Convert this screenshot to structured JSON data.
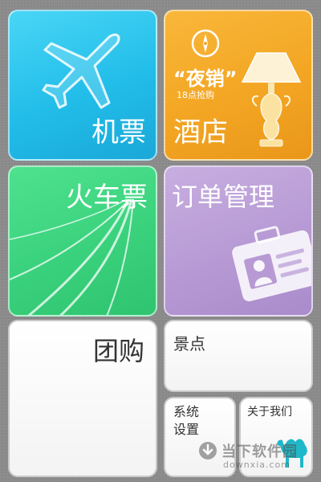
{
  "tiles": {
    "flight": {
      "label": "机票",
      "color": "#22bde9",
      "icon": "airplane-icon"
    },
    "hotel": {
      "label": "酒店",
      "color": "#f3a623",
      "promo_title": "“夜销”",
      "promo_subtitle": "18点抢购",
      "icons": [
        "compass-icon",
        "lamp-icon"
      ]
    },
    "train": {
      "label": "火车票",
      "color": "#3ad17d",
      "icon": "railway-tracks-icon"
    },
    "orders": {
      "label": "订单管理",
      "color": "#b79ad4",
      "icon": "id-card-icon"
    },
    "groupbuy": {
      "label": "团购"
    },
    "scenic": {
      "label": "景点"
    },
    "settings": {
      "label": "系统设置"
    },
    "about": {
      "label": "关于我们",
      "icon": "camel-icon"
    }
  },
  "watermark": {
    "title": "当下软件园",
    "url": "downxia.com",
    "icon": "download-arrow-icon"
  }
}
